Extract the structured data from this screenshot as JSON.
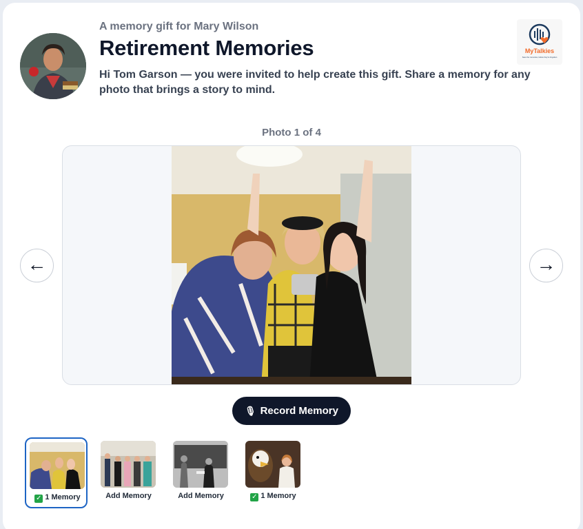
{
  "header": {
    "subtitle": "A memory gift for Mary Wilson",
    "title": "Retirement Memories",
    "intro": "Hi Tom Garson — you were invited to help create this gift. Share a memory for any photo that brings a story to mind."
  },
  "logo": {
    "text": "MyTalkies",
    "tagline": "Save the memories, before they're forgotten",
    "accent": "#f26b2a",
    "brand": "#1c3a5e"
  },
  "viewer": {
    "counter": "Photo 1 of 4",
    "prev_label": "←",
    "next_label": "→"
  },
  "record": {
    "icon": "microphone-icon",
    "label": "Record Memory"
  },
  "thumbnails": [
    {
      "label": "1 Memory",
      "has_memory": true,
      "selected": true
    },
    {
      "label": "Add Memory",
      "has_memory": false,
      "selected": false
    },
    {
      "label": "Add Memory",
      "has_memory": false,
      "selected": false
    },
    {
      "label": "1 Memory",
      "has_memory": true,
      "selected": false
    }
  ],
  "colors": {
    "primary_dark": "#0f172a",
    "selected_border": "#1d64c4",
    "check_green": "#22a447",
    "muted_text": "#6b7280"
  }
}
